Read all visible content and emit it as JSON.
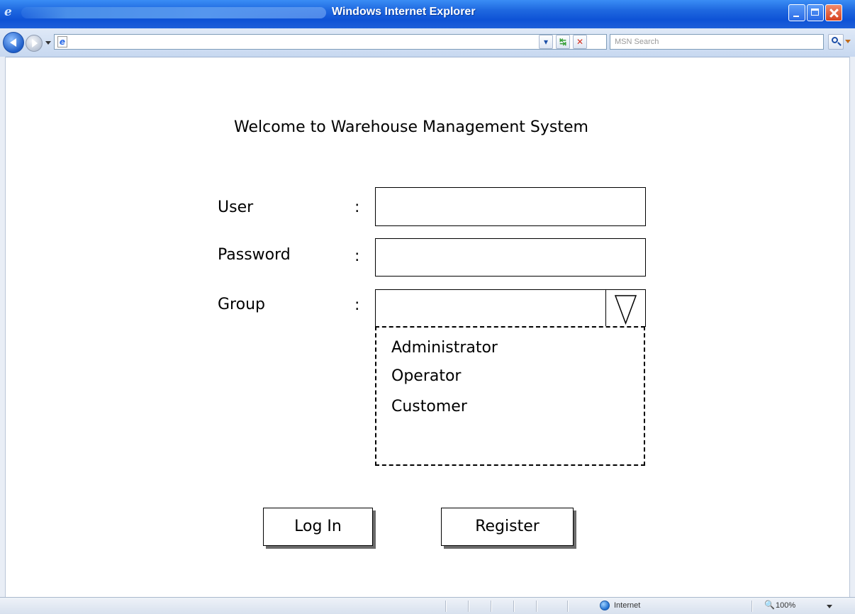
{
  "window": {
    "title": "Windows Internet Explorer"
  },
  "toolbar": {
    "address_value": "",
    "search_placeholder": "MSN Search"
  },
  "statusbar": {
    "zone": "Internet",
    "zoom": "100%"
  },
  "page": {
    "heading": "Welcome to Warehouse Management System",
    "form": {
      "user_label": "User",
      "password_label": "Password",
      "group_label": "Group",
      "colon": ":",
      "user_value": "",
      "password_value": "",
      "group_value": "",
      "group_options": [
        "Administrator",
        "Operator",
        "Customer"
      ]
    },
    "buttons": {
      "login": "Log In",
      "register": "Register"
    }
  },
  "icons": {
    "browser_logo": "ie-logo-icon",
    "back": "back-arrow-icon",
    "forward": "forward-arrow-icon",
    "refresh": "refresh-icon",
    "stop": "stop-icon",
    "search": "search-icon",
    "zone": "globe-icon",
    "dropdown": "triangle-down-icon"
  },
  "colors": {
    "titlebar": "#0e52d6",
    "toolbar": "#c7d8f0",
    "page_background": "#ffffff",
    "ink": "#000000"
  }
}
